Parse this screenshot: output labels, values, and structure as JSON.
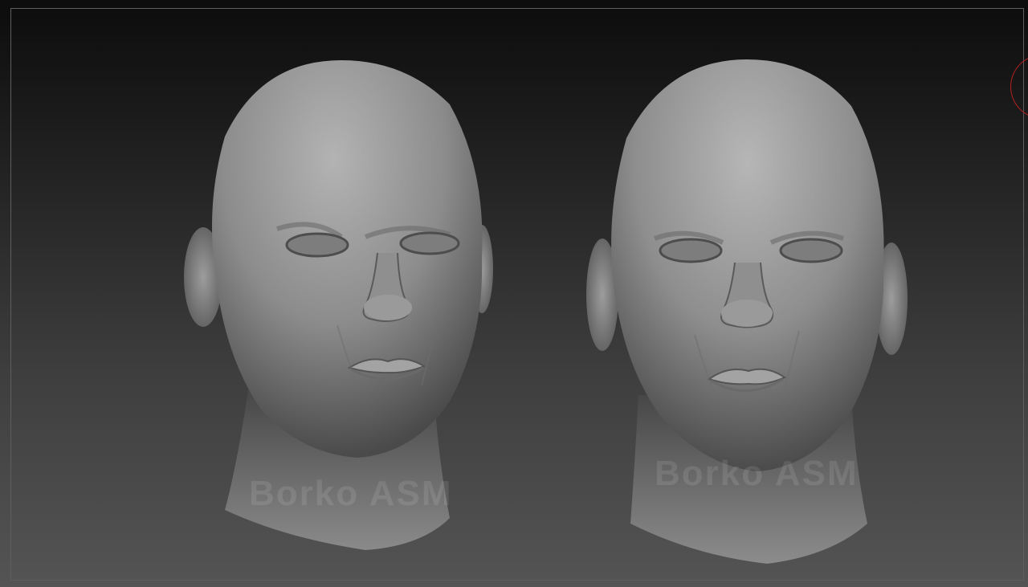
{
  "canvas": {
    "watermark_left": "Borko ASM",
    "watermark_right": "Borko ASM"
  },
  "models": [
    {
      "name": "sculpted-head-left"
    },
    {
      "name": "sculpted-head-right"
    }
  ],
  "colors": {
    "background_top": "#0c0c0c",
    "background_bottom": "#545454",
    "frame": "#5e5e5e",
    "gizmo": "#b52020",
    "clay": "#8e8e8e"
  },
  "icons": {
    "gizmo": "rotation-gizmo-icon"
  }
}
